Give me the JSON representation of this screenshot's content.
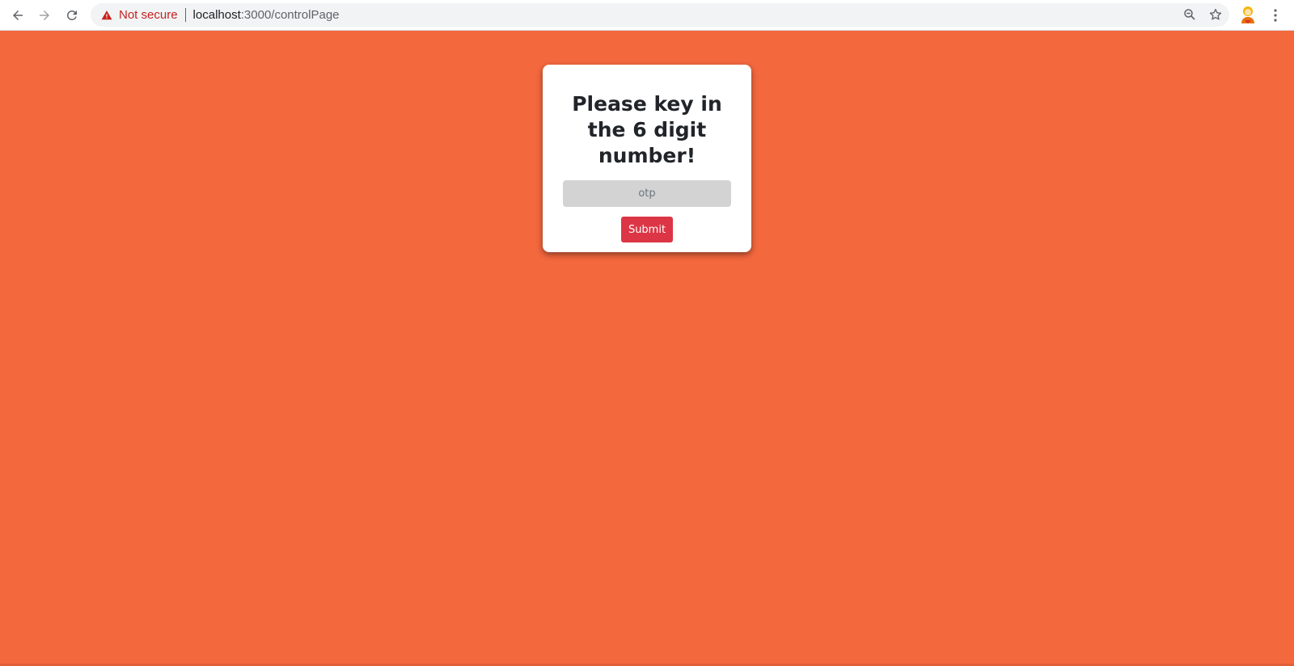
{
  "browser": {
    "security_label": "Not secure",
    "url_host": "localhost",
    "url_path": ":3000/controlPage",
    "icons": [
      "back-icon",
      "forward-icon",
      "reload-icon",
      "warning-icon",
      "zoom-icon",
      "bookmark-star-icon",
      "profile-avatar",
      "more-menu-icon"
    ]
  },
  "page": {
    "background_color": "#f4683e",
    "card": {
      "heading": "Please key in the 6 digit number!",
      "otp_placeholder": "otp",
      "otp_value": "",
      "submit_label": "Submit",
      "submit_color": "#dc3545"
    }
  }
}
